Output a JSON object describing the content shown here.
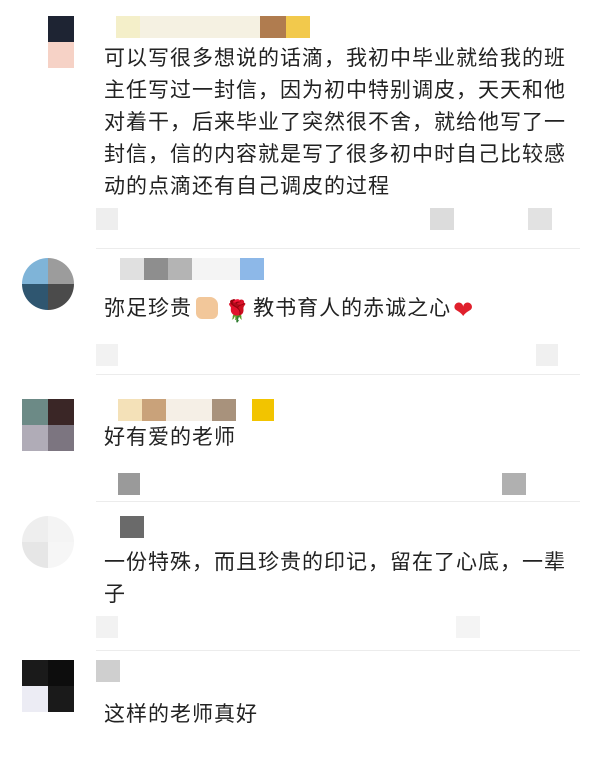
{
  "comments": [
    {
      "text": "可以写很多想说的话滴，我初中毕业就给我的班主任写过一封信，因为初中特别调皮，天天和他对着干，后来毕业了突然很不舍，就给他写了一封信，信的内容就是写了很多初中时自己比较感动的点滴还有自己调皮的过程",
      "avatar_colors": [
        "#ffffff",
        "#1e2433",
        "#ffffff",
        "#f6d2c6"
      ],
      "name_colors": [
        "#f4efc9",
        "#f5f1e2",
        "#b07c4f",
        "#f2c94c"
      ]
    },
    {
      "text_before": "弥足珍贵",
      "text_middle": "教书育人的赤诚之心",
      "emoji_thumb": "thumbs-up-icon",
      "emoji_rose": "🌹",
      "emoji_heart": "❤",
      "avatar_colors": [
        "#7fb4d8",
        "#9c9c9c",
        "#2f5670",
        "#4b4b4b"
      ],
      "name_colors": [
        "#e0e0e0",
        "#8e8e8e",
        "#b4b4b4",
        "#f4f4f4",
        "#8db8e8"
      ]
    },
    {
      "text": "好有爱的老师",
      "avatar_colors": [
        "#6c8a86",
        "#3a2626",
        "#b0acb7",
        "#7c7580"
      ],
      "name_colors": [
        "#f4e1b8",
        "#c9a27a",
        "#f5efe6",
        "#a8927c",
        "#f2c400"
      ]
    },
    {
      "text": "一份特殊，而且珍贵的印记，留在了心底，一辈子",
      "avatar_colors": [
        "#eeeeee",
        "#f4f4f4",
        "#e6e6e6",
        "#f6f6f6"
      ],
      "name_colors": [
        "#6a6a6a"
      ]
    },
    {
      "text": "这样的老师真好",
      "avatar_colors": [
        "#1a1a1a",
        "#0d0d0d",
        "#ececf4",
        "#1a1a1a"
      ],
      "name_colors": [
        "#cfcfcf"
      ]
    }
  ]
}
